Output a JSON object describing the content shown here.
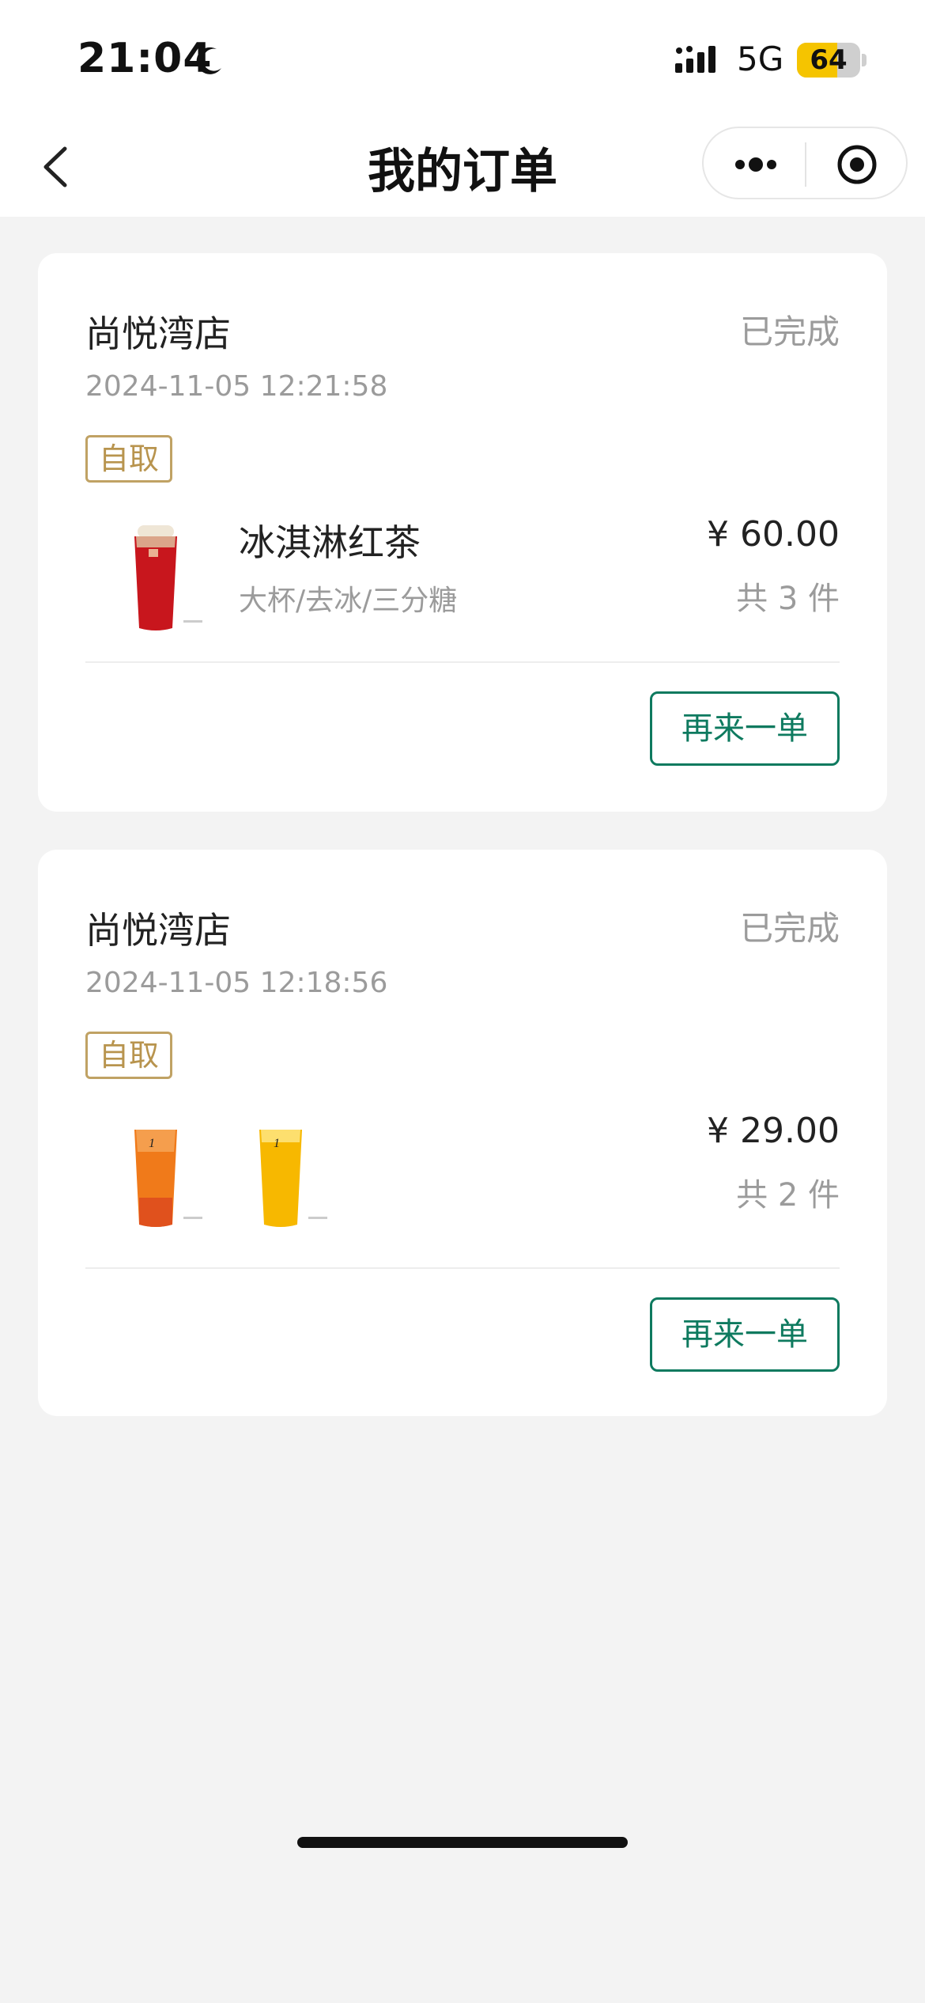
{
  "status_bar": {
    "time": "21:04",
    "network": "5G",
    "battery": "64",
    "battery_level": 0.64
  },
  "nav": {
    "title": "我的订单"
  },
  "orders": [
    {
      "store": "尚悦湾店",
      "status": "已完成",
      "time": "2024-11-05 12:21:58",
      "tag": "自取",
      "item_name": "冰淇淋红茶",
      "item_spec": "大杯/去冰/三分糖",
      "price": "¥ 60.00",
      "count": "共 3 件",
      "reorder_label": "再来一单",
      "cups": [
        "red-tea-cup"
      ]
    },
    {
      "store": "尚悦湾店",
      "status": "已完成",
      "time": "2024-11-05 12:18:56",
      "tag": "自取",
      "price": "¥ 29.00",
      "count": "共 2 件",
      "reorder_label": "再来一单",
      "cups": [
        "orange-tea-cup",
        "lemon-tea-cup"
      ]
    }
  ],
  "colors": {
    "accent_green": "#0e7a5f",
    "tag_gold": "#b8944e",
    "muted_text": "#9b9b9b",
    "battery_yellow": "#f5c400"
  }
}
